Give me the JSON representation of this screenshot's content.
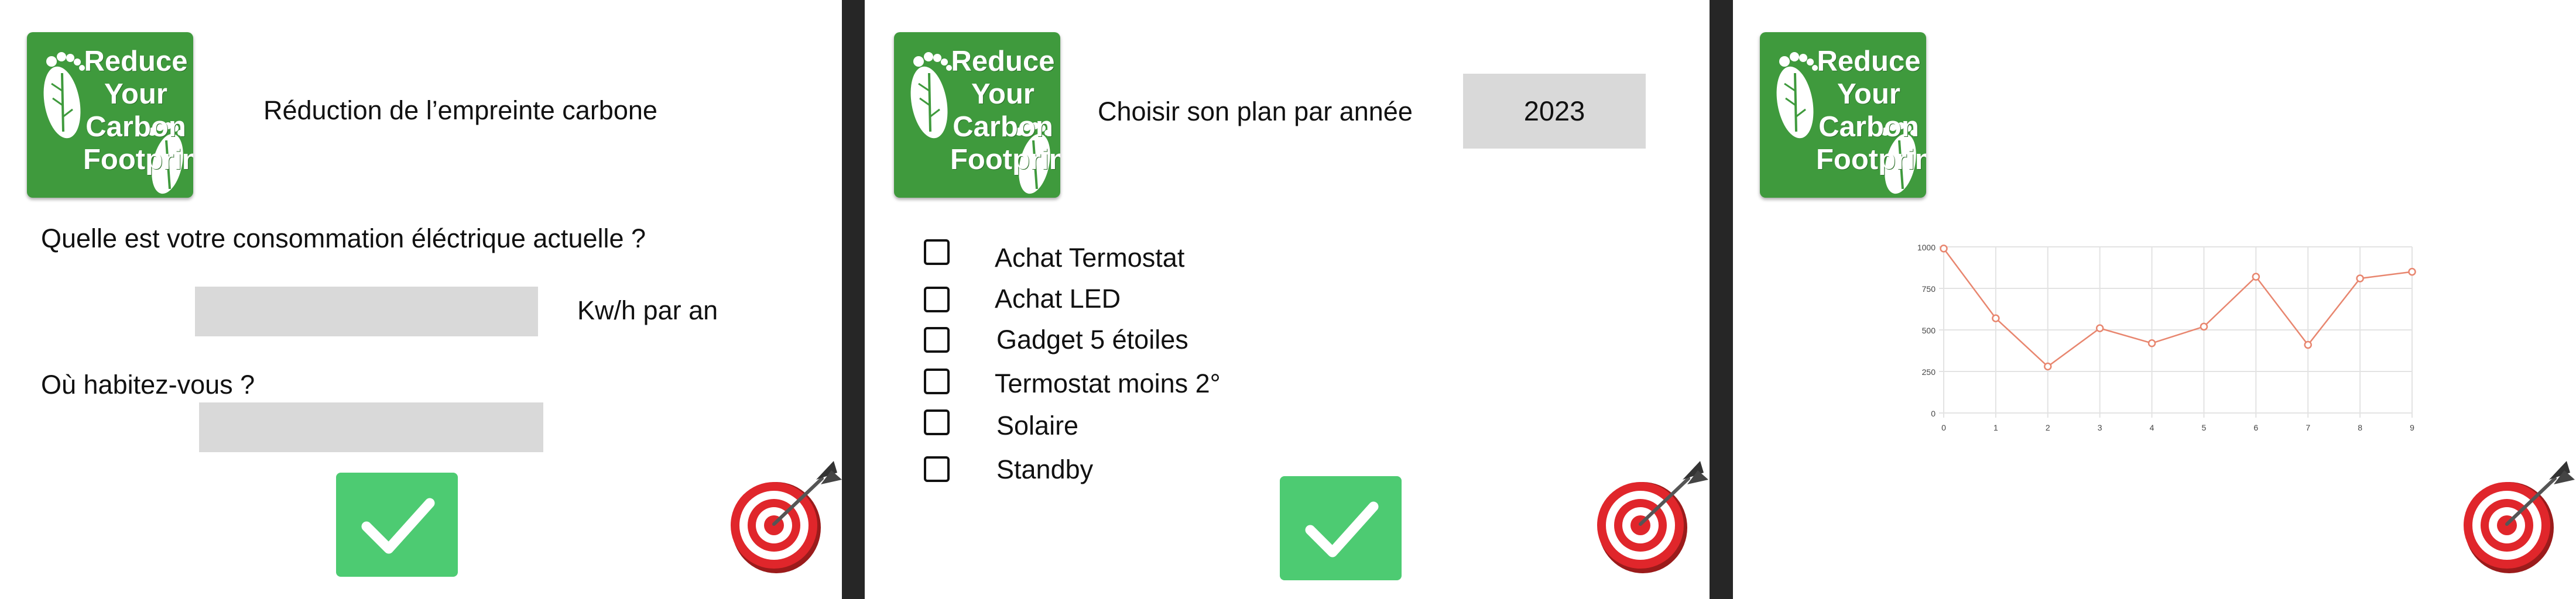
{
  "logo": {
    "text": "Reduce\nYour\nCarbon\nFootprint"
  },
  "screen1": {
    "title": "Réduction de l’empreinte carbone",
    "question_consumption": "Quelle est votre consommation éléctrique actuelle ?",
    "consumption_unit": "Kw/h par an",
    "consumption_value": "",
    "question_location": "Où habitez-vous ?",
    "location_value": ""
  },
  "screen2": {
    "title": "Choisir son plan par année",
    "year": "2023",
    "options": [
      {
        "label": "Achat Termostat",
        "checked": false
      },
      {
        "label": "Achat LED",
        "checked": false
      },
      {
        "label": "Gadget 5 étoiles",
        "checked": false
      },
      {
        "label": "Termostat moins 2°",
        "checked": false
      },
      {
        "label": "Solaire",
        "checked": false
      },
      {
        "label": "Standby",
        "checked": false
      }
    ]
  },
  "colors": {
    "logo_green": "#3f9a3d",
    "confirm_green": "#4dcb72",
    "field_gray": "#d9d9d9",
    "line_color": "#e8866f"
  },
  "icons": {
    "confirm": "checkmark-icon",
    "goal": "dartboard-target-icon",
    "logo": "footprint-leaf-icon"
  },
  "chart_data": {
    "type": "line",
    "x": [
      0,
      1,
      2,
      3,
      4,
      5,
      6,
      7,
      8,
      9
    ],
    "series": [
      {
        "values": [
          990,
          570,
          280,
          510,
          420,
          520,
          820,
          410,
          810,
          850
        ]
      }
    ],
    "xlim": [
      0,
      9
    ],
    "ylim": [
      0,
      1000
    ],
    "yticks": [
      "0",
      "250",
      "500",
      "750",
      "1000"
    ],
    "xticks": [
      "0",
      "1",
      "2",
      "3",
      "4",
      "5",
      "6",
      "7",
      "8",
      "9"
    ],
    "grid": true
  }
}
